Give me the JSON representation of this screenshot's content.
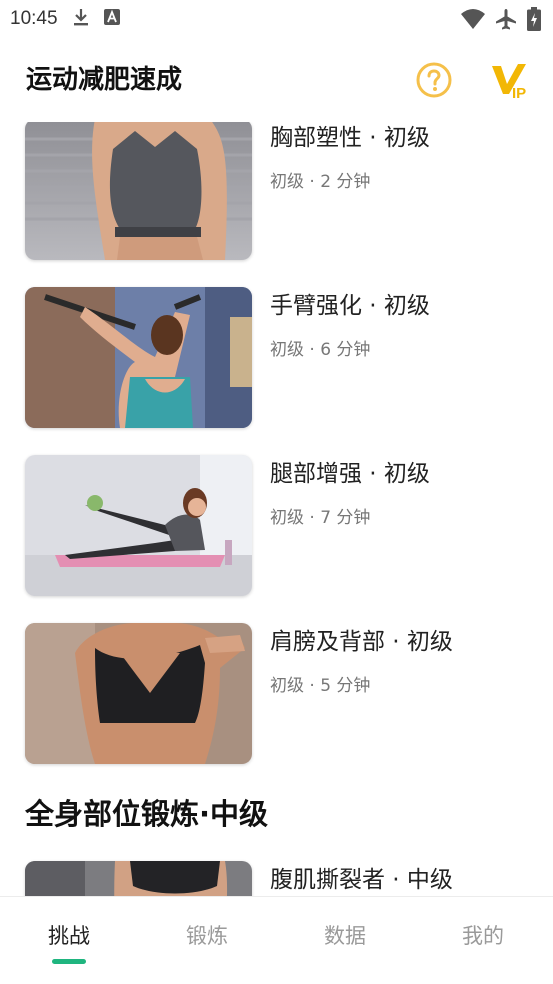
{
  "status_bar": {
    "time": "10:45",
    "icons": [
      "download-icon",
      "font-icon",
      "wifi-icon",
      "airplane-icon",
      "battery-charging-icon"
    ]
  },
  "header": {
    "title": "运动减肥速成",
    "help_icon": "question-circle-icon",
    "vip_icon": "vip-badge-icon",
    "vip_text": "IP"
  },
  "workouts_beginner": [
    {
      "title": "胸部塑性 · 初级",
      "subtitle": "初级 · 2 分钟",
      "image": "chest-workout-photo"
    },
    {
      "title": "手臂强化 · 初级",
      "subtitle": "初级 · 6 分钟",
      "image": "arm-workout-photo"
    },
    {
      "title": "腿部增强 · 初级",
      "subtitle": "初级 · 7 分钟",
      "image": "leg-workout-photo"
    },
    {
      "title": "肩膀及背部 · 初级",
      "subtitle": "初级 · 5 分钟",
      "image": "shoulder-back-workout-photo"
    }
  ],
  "section_intermediate": {
    "title": "全身部位锻炼·中级",
    "items": [
      {
        "title": "腹肌撕裂者 · 中级",
        "image": "abs-workout-photo"
      }
    ]
  },
  "bottom_nav": {
    "tabs": [
      {
        "label": "挑战",
        "active": true
      },
      {
        "label": "锻炼",
        "active": false
      },
      {
        "label": "数据",
        "active": false
      },
      {
        "label": "我的",
        "active": false
      }
    ]
  },
  "colors": {
    "accent_green": "#1fb57f",
    "vip_gold": "#f2b705",
    "help_gold": "#f5c04a",
    "text_primary": "#222222",
    "text_secondary": "#777777",
    "tab_inactive": "#9a9a9a"
  }
}
